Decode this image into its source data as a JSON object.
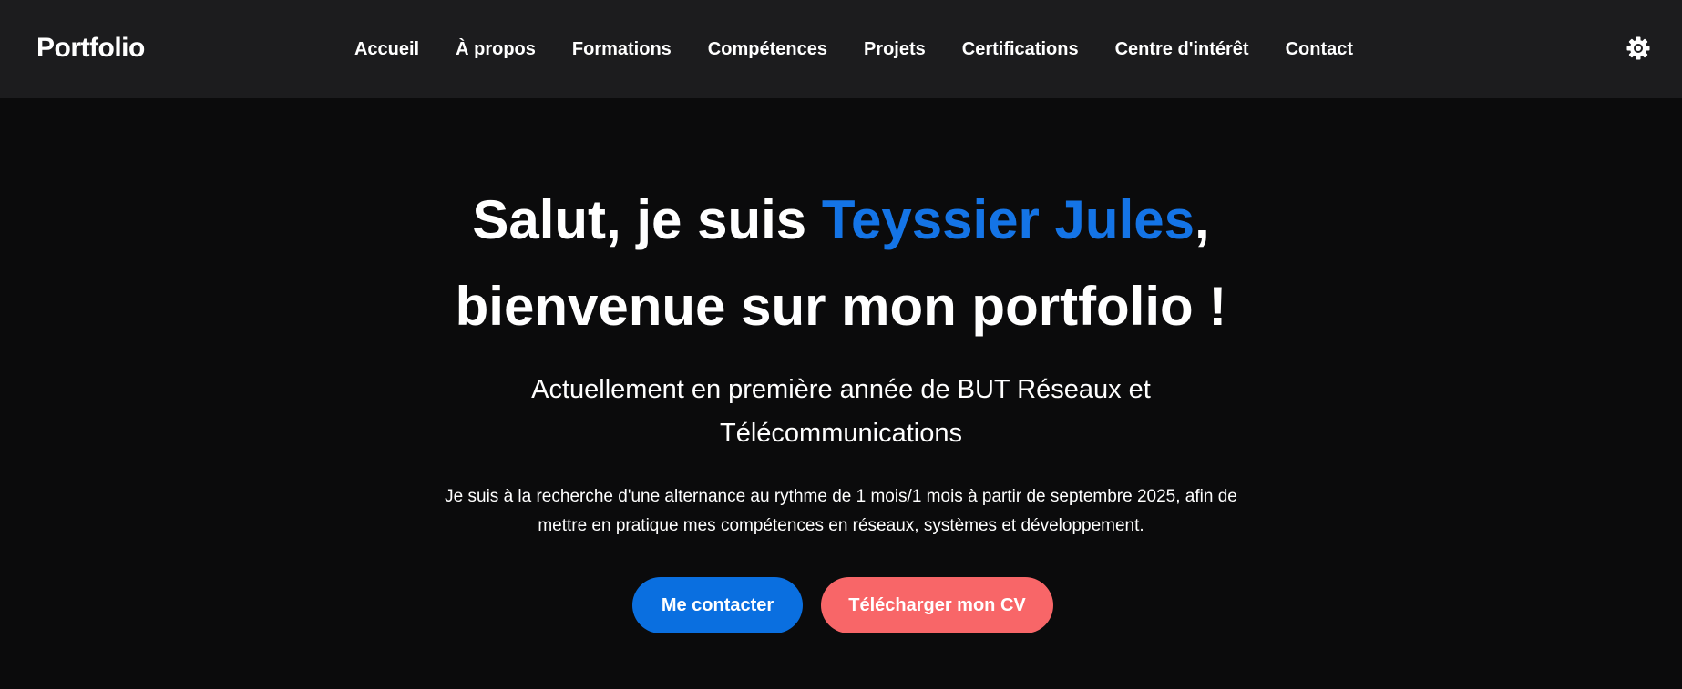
{
  "header": {
    "brand": "Portfolio",
    "nav": [
      "Accueil",
      "À propos",
      "Formations",
      "Compétences",
      "Projets",
      "Certifications",
      "Centre d'intérêt",
      "Contact"
    ],
    "theme_toggle_icon": "gear-icon"
  },
  "hero": {
    "greeting_prefix": "Salut, je suis ",
    "name": "Teyssier Jules",
    "greeting_suffix": ",",
    "welcome": "bienvenue sur mon portfolio !",
    "subtitle_line1": "Actuellement en première année de BUT Réseaux et",
    "subtitle_line2": "Télécommunications",
    "description_line1": "Je suis à la recherche d'une alternance au rythme de 1 mois/1 mois à partir de septembre 2025, afin de",
    "description_line2": "mettre en pratique mes compétences en réseaux, systèmes et développement.",
    "contact_button": "Me contacter",
    "cv_button": "Télécharger mon CV"
  },
  "colors": {
    "background": "#0b0b0c",
    "navbar": "#1c1c1e",
    "accent_blue": "#1474e6",
    "button_blue": "#0a6fe0",
    "button_coral": "#f86668"
  }
}
